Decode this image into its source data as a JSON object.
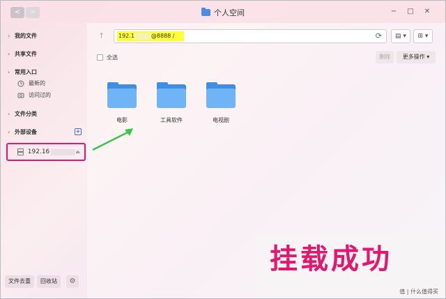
{
  "window": {
    "title": "个人空间"
  },
  "nav": {
    "back": "<",
    "forward": ">"
  },
  "window_controls": {
    "minimize": "−",
    "maximize": "□",
    "close": "✕"
  },
  "sidebar": {
    "groups": [
      {
        "label": "我的文件"
      },
      {
        "label": "共享文件"
      },
      {
        "label": "常用入口",
        "items": [
          {
            "label": "最新的",
            "icon": "clock-icon"
          },
          {
            "label": "访问过的",
            "icon": "history-icon"
          }
        ]
      },
      {
        "label": "文件分类"
      },
      {
        "label": "外部设备",
        "add": "+"
      }
    ],
    "device": {
      "label": "192.16",
      "icon": "server-icon",
      "eject": "⏏"
    },
    "bottom": {
      "dedupe": "文件去重",
      "recycle": "回收站"
    }
  },
  "address": {
    "prefix": "192.1",
    "suffix": "@8888 /"
  },
  "toolbar": {
    "select_all": "全选",
    "delete": "删除",
    "more": "更多操作 ▾",
    "view_list": "▤ ▾",
    "view_grid": "⊞ ▾"
  },
  "folders": [
    {
      "name": "电影"
    },
    {
      "name": "工具软件"
    },
    {
      "name": "电视剧"
    }
  ],
  "overlay": {
    "text": "挂载成功"
  },
  "watermark": {
    "text": "值 | 什么值得买"
  },
  "colors": {
    "highlight": "#ffff38",
    "accent": "#e2186f",
    "folder": "#6eb4f7",
    "arrow": "#3cc44a"
  }
}
